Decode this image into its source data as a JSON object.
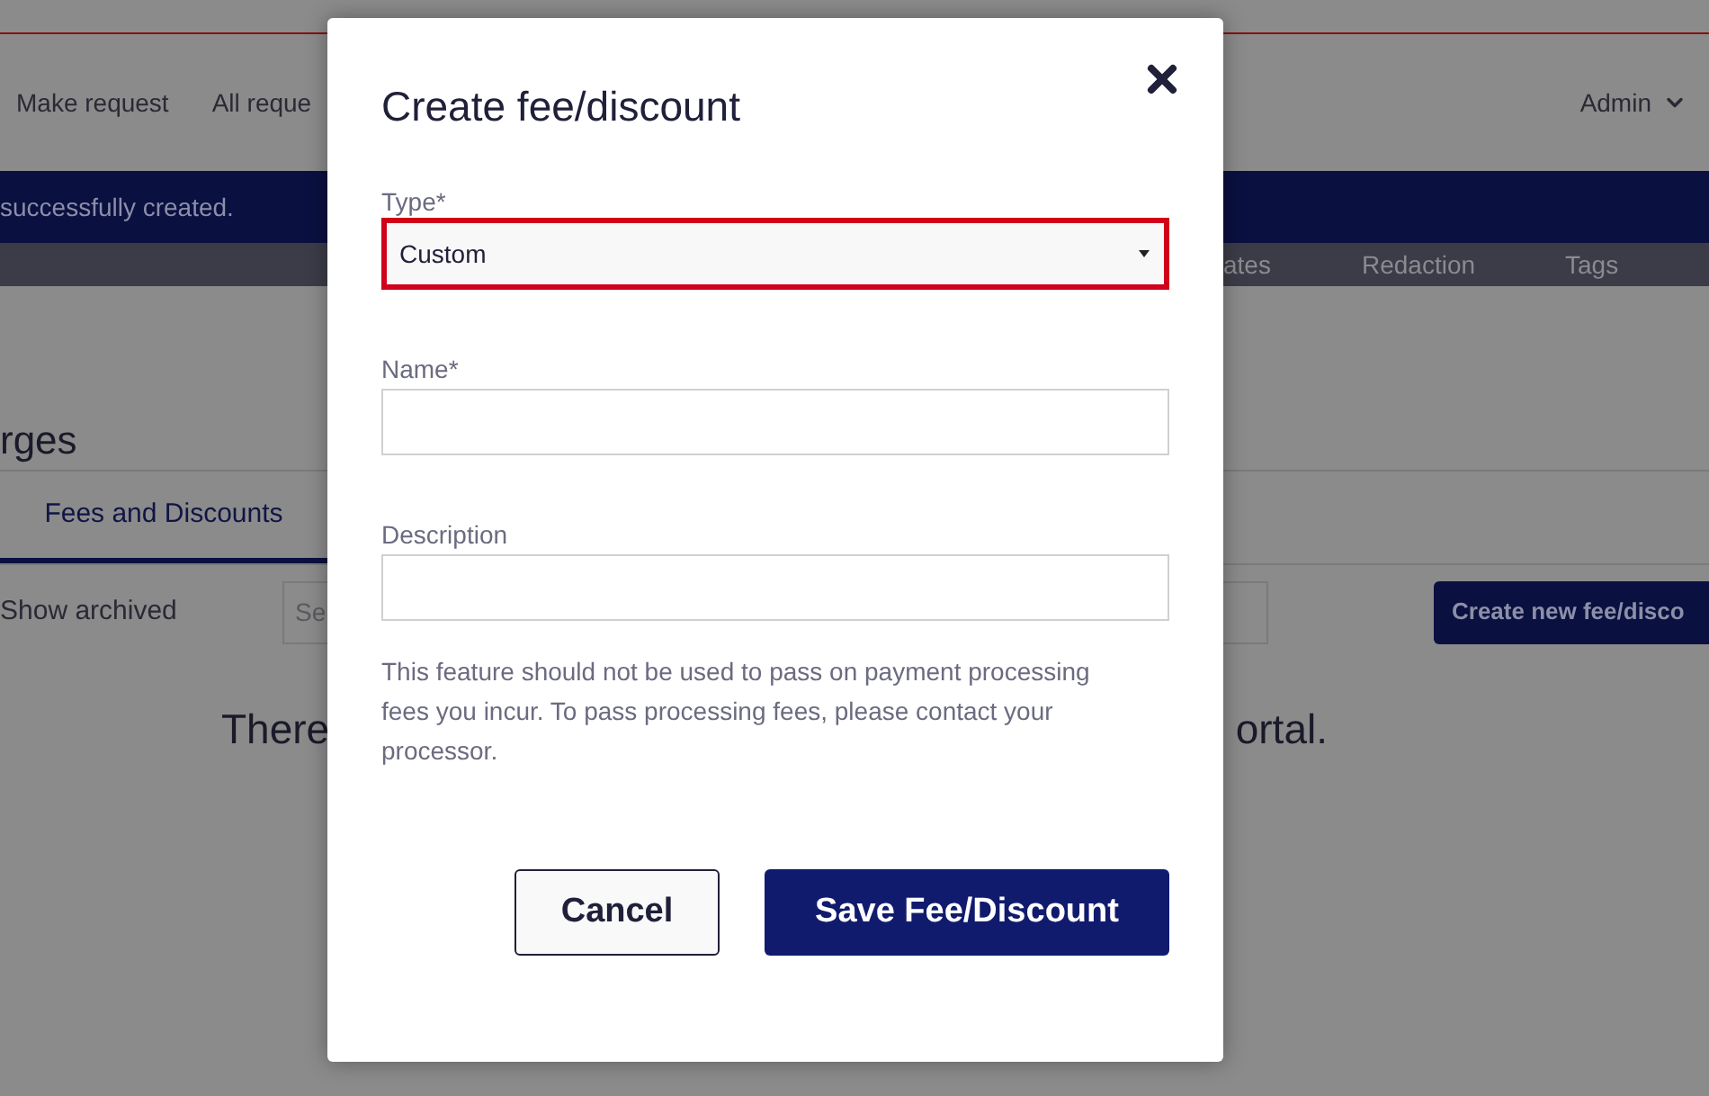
{
  "nav": {
    "links": [
      {
        "label": "Make request"
      },
      {
        "label": "All reque"
      }
    ],
    "user": {
      "label": "Admin"
    }
  },
  "banner": {
    "message": "successfully created."
  },
  "subnav": {
    "items": [
      {
        "label": "ates"
      },
      {
        "label": "Redaction"
      },
      {
        "label": "Tags"
      }
    ]
  },
  "page": {
    "heading": "rges",
    "tabs": [
      {
        "label": "Fees and Discounts",
        "selected": true
      }
    ],
    "show_archived": "Show archived",
    "search": {
      "placeholder": "Se"
    },
    "create_button": "Create new fee/disco",
    "empty_message": {
      "left": "There",
      "right": "ortal."
    }
  },
  "modal": {
    "title": "Create fee/discount",
    "fields": [
      {
        "kind": "select",
        "label": "Type*",
        "value": "Custom",
        "highlighted": true
      },
      {
        "kind": "text",
        "label": "Name*",
        "highlighted": false
      },
      {
        "kind": "text",
        "label": "Description",
        "highlighted": false
      }
    ],
    "note": "This feature should not be used to pass on payment processing fees you incur. To pass processing fees, please contact your processor.",
    "buttons": [
      {
        "label": "Cancel",
        "kind": "secondary"
      },
      {
        "label": "Save Fee/Discount",
        "kind": "primary"
      }
    ]
  }
}
